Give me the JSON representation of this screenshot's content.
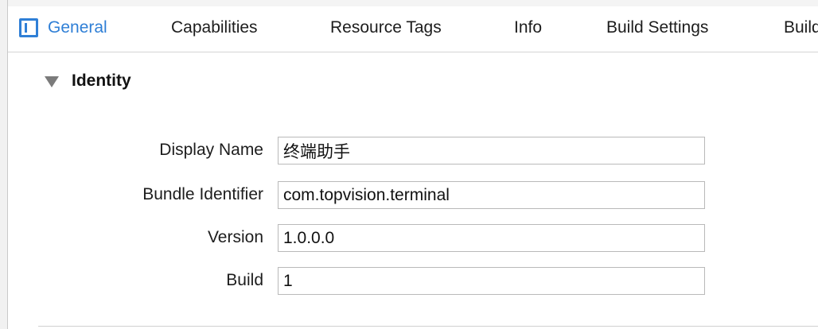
{
  "tabs": {
    "general": "General",
    "capabilities": "Capabilities",
    "resource_tags": "Resource Tags",
    "info": "Info",
    "build_settings": "Build Settings",
    "build_phases": "Build"
  },
  "identity": {
    "title": "Identity",
    "fields": {
      "display_name": {
        "label": "Display Name",
        "value": "终端助手"
      },
      "bundle_identifier": {
        "label": "Bundle Identifier",
        "value": "com.topvision.terminal"
      },
      "version": {
        "label": "Version",
        "value": "1.0.0.0"
      },
      "build": {
        "label": "Build",
        "value": "1"
      }
    }
  },
  "colors": {
    "accent": "#2f7fd6",
    "disclosure": "#7b7b7b"
  },
  "icons": {
    "sidebar_toggle": "sidebar-toggle-icon",
    "disclosure": "disclosure-triangle-icon"
  }
}
